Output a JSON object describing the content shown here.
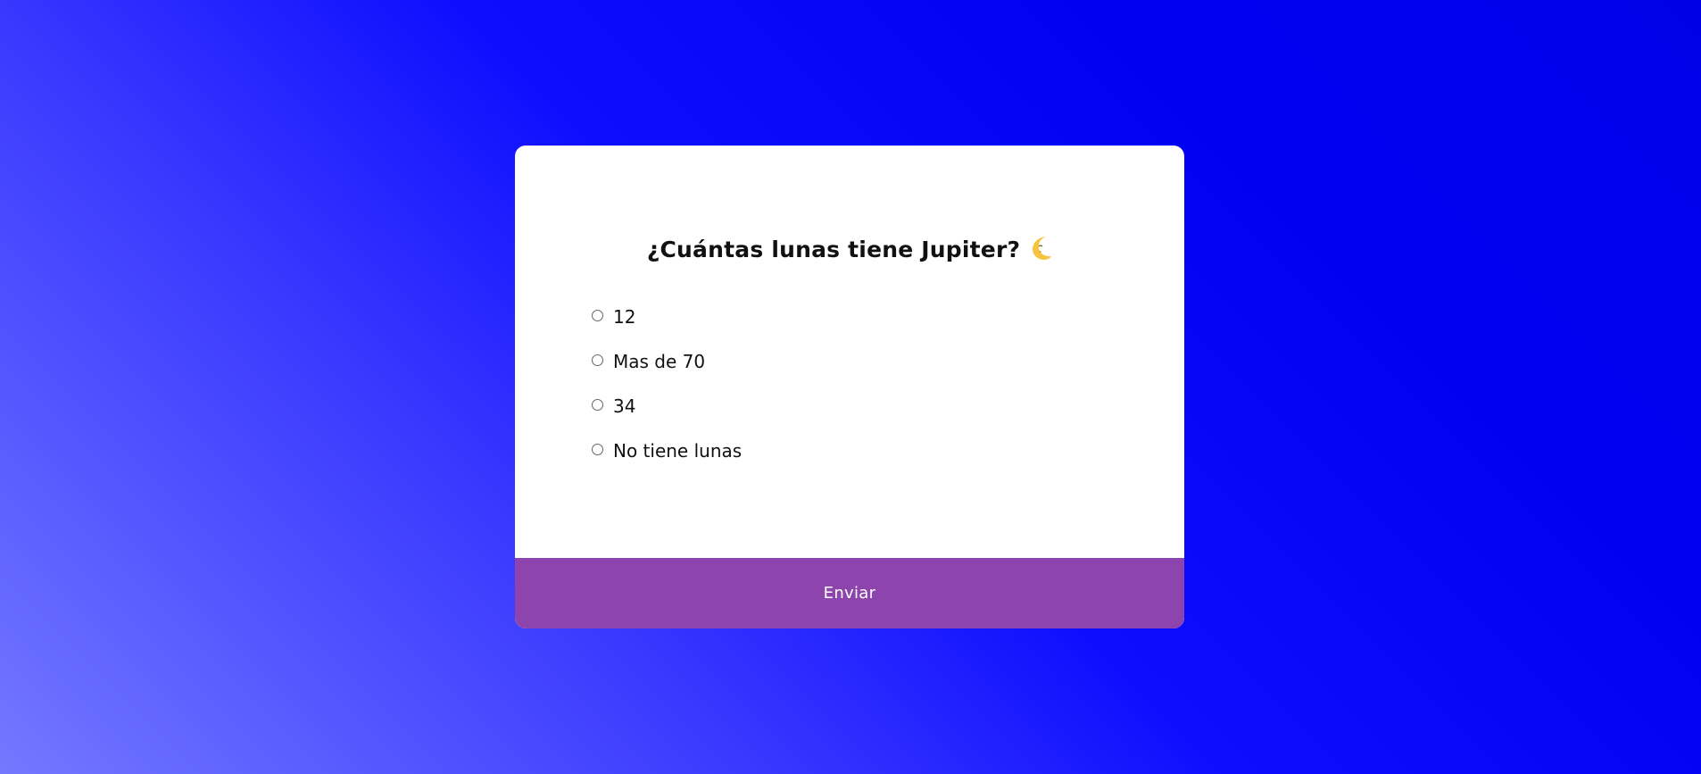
{
  "quiz": {
    "question": "¿Cuántas lunas tiene Jupiter?",
    "question_icon": "crescent-moon-icon",
    "answers": [
      {
        "label": "12",
        "selected": false
      },
      {
        "label": "Mas de 70",
        "selected": false
      },
      {
        "label": "34",
        "selected": false
      },
      {
        "label": "No tiene lunas",
        "selected": false
      }
    ],
    "submit_label": "Enviar"
  },
  "colors": {
    "background_gradient_start": "#7478ff",
    "background_gradient_end": "#0000e8",
    "card_background": "#ffffff",
    "submit_button": "#8e44ad",
    "moon": "#f5c542"
  }
}
